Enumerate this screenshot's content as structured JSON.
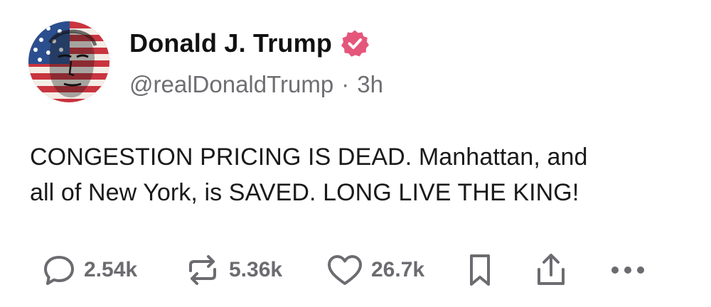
{
  "author": {
    "display_name": "Donald J. Trump",
    "handle": "@realDonaldTrump",
    "separator": "·",
    "time_ago": "3h",
    "avatar_icon": "flag-portrait-avatar",
    "verified_icon": "verified-badge-icon",
    "verified_color": "#e5567b"
  },
  "post": {
    "text_line1": "CONGESTION PRICING IS DEAD. Manhattan, and",
    "text_line2": "all of New York, is SAVED. LONG LIVE THE KING!"
  },
  "actions": {
    "replies": "2.54k",
    "reposts": "5.36k",
    "likes": "26.7k",
    "icons": [
      "reply-icon",
      "repost-icon",
      "like-icon",
      "bookmark-icon",
      "share-icon",
      "more-icon"
    ],
    "icon_color": "#6b6b70"
  }
}
